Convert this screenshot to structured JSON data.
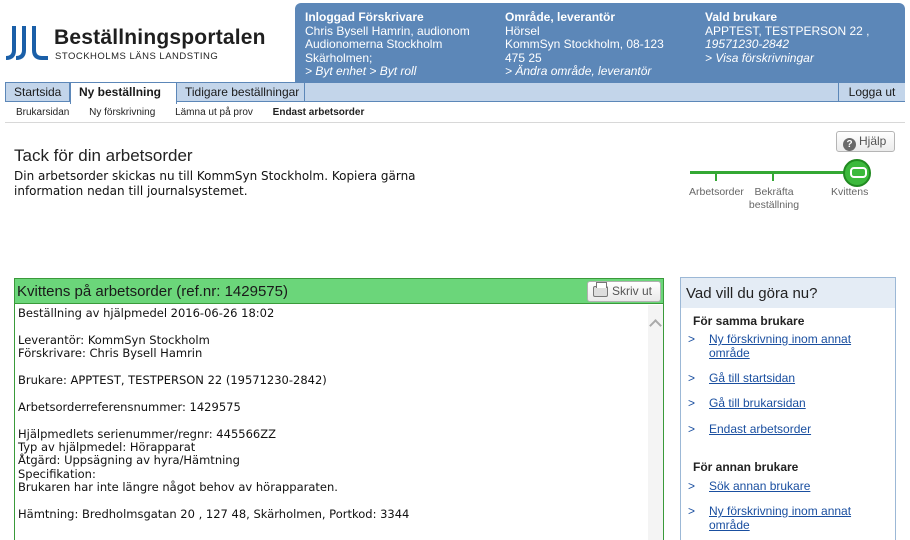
{
  "logo": {
    "title": "Beställningsportalen",
    "subtitle": "STOCKHOLMS LÄNS LANDSTING"
  },
  "infobar": {
    "prescriber": {
      "heading": "Inloggad Förskrivare",
      "name": "Chris Bysell Hamrin, audionom",
      "org_line1": "Audionomerna Stockholm",
      "org_line2": "Skärholmen;",
      "links": "> Byt enhet > Byt roll"
    },
    "area": {
      "heading": "Område, leverantör",
      "area": "Hörsel",
      "supplier_line1": "KommSyn Stockholm, 08-123",
      "supplier_line2": "475 25",
      "link": "> Ändra område, leverantör"
    },
    "client": {
      "heading": "Vald brukare",
      "name": "APPTEST, TESTPERSON 22 ,",
      "pnr": "19571230-2842",
      "link": "> Visa förskrivningar"
    }
  },
  "nav": {
    "tabs": [
      "Startsida",
      "Ny beställning",
      "Tidigare beställningar"
    ],
    "active": "Ny beställning",
    "logout": "Logga ut"
  },
  "subnav": {
    "items": [
      "Brukarsidan",
      "Ny förskrivning",
      "Lämna ut på prov",
      "Endast arbetsorder"
    ],
    "current": "Endast arbetsorder"
  },
  "help_label": "Hjälp",
  "page": {
    "title": "Tack för din arbetsorder",
    "description": "Din arbetsorder skickas nu till KommSyn Stockholm. Kopiera gärna information nedan till journalsystemet."
  },
  "progress": {
    "steps": [
      "Arbetsorder",
      "Bekräfta beställning",
      "Kvittens"
    ],
    "current": "Kvittens"
  },
  "receipt": {
    "title": "Kvittens på arbetsorder (ref.nr: 1429575)",
    "print_label": "Skriv ut",
    "lines": [
      "Beställning av hjälpmedel 2016-06-26 18:02",
      "",
      "Leverantör: KommSyn Stockholm",
      "Förskrivare: Chris Bysell Hamrin",
      "",
      "Brukare: APPTEST, TESTPERSON 22 (19571230-2842)",
      "",
      "Arbetsorderreferensnummer: 1429575",
      "",
      "Hjälpmedlets serienummer/regnr: 445566ZZ",
      "Typ av hjälpmedel: Hörapparat",
      "Åtgärd: Uppsägning av hyra/Hämtning",
      "Specifikation:",
      "Brukaren har inte längre något behov av hörapparaten.",
      "",
      "Hämtning: Bredholmsgatan 20 , 127 48, Skärholmen, Portkod: 3344"
    ]
  },
  "side": {
    "heading": "Vad vill du göra nu?",
    "same_client_heading": "För samma brukare",
    "same_client_links": [
      "Ny förskrivning inom annat område",
      "Gå till startsidan",
      "Gå till brukarsidan",
      "Endast arbetsorder"
    ],
    "other_client_heading": "För annan brukare",
    "other_client_links": [
      "Sök annan brukare",
      "Ny förskrivning inom annat område"
    ]
  },
  "colors": {
    "header_blue": "#5c87b8",
    "nav_blue": "#c3d5ea",
    "receipt_green": "#6bd67a",
    "progress_green": "#34a834",
    "link_blue": "#1a4fa0"
  }
}
